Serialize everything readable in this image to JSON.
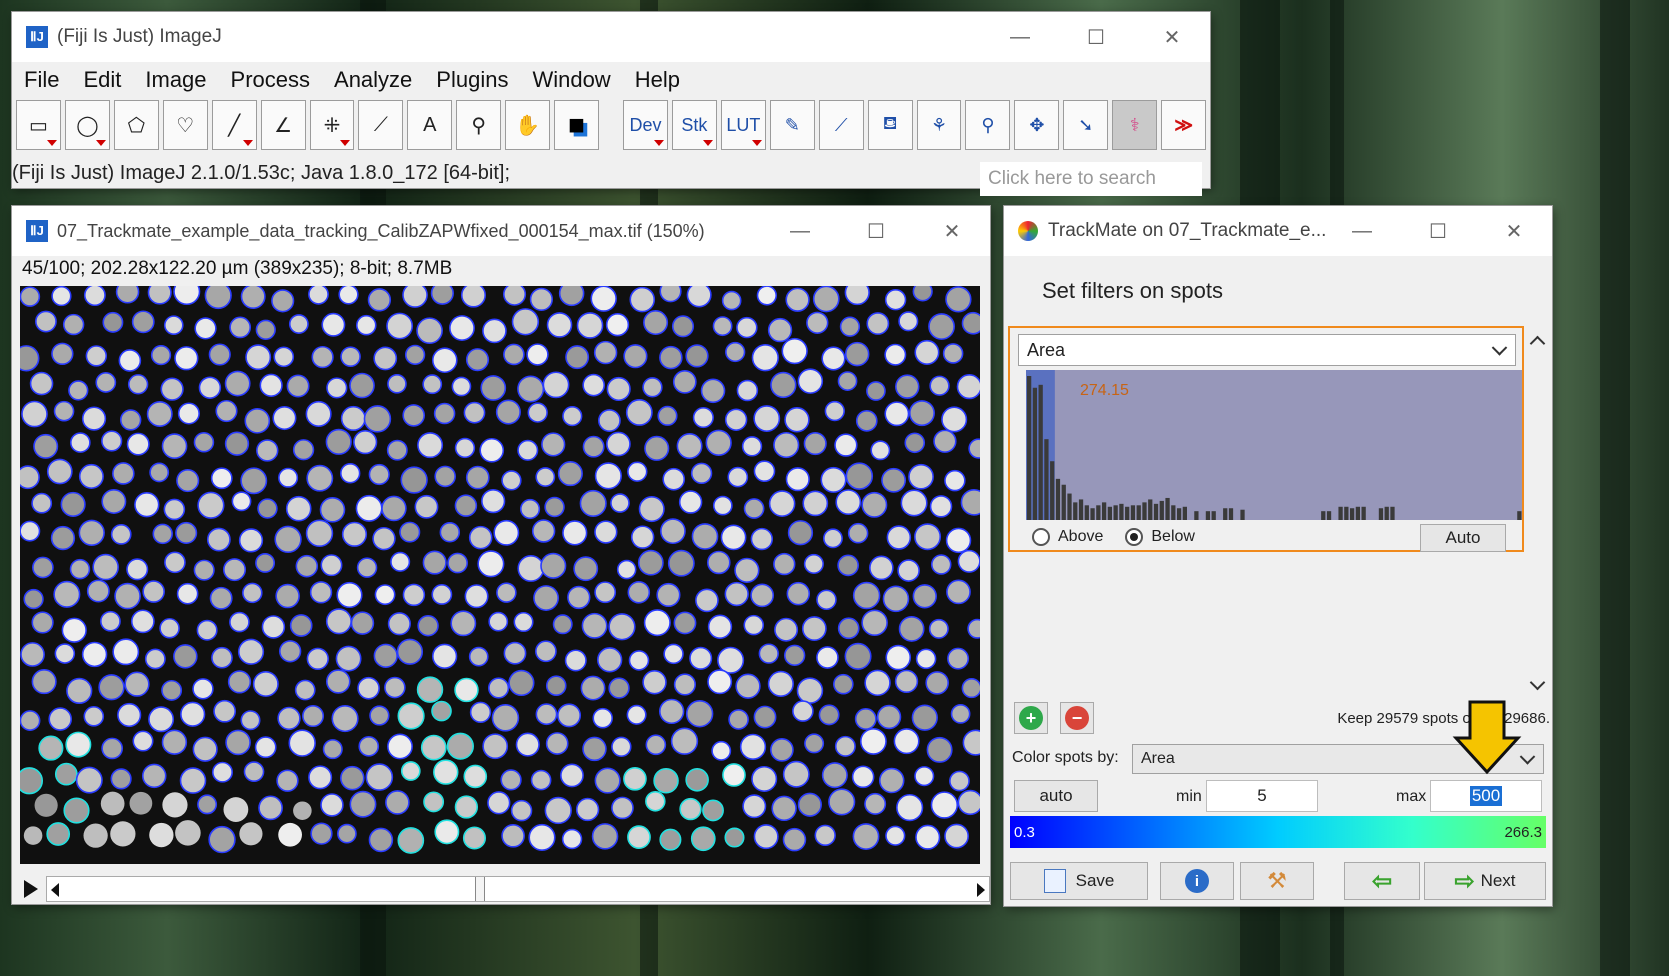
{
  "imagej": {
    "title": "(Fiji Is Just) ImageJ",
    "menus": [
      "File",
      "Edit",
      "Image",
      "Process",
      "Analyze",
      "Plugins",
      "Window",
      "Help"
    ],
    "tools": [
      {
        "name": "rectangle-tool-icon",
        "glyph": "▭",
        "dropdown": true
      },
      {
        "name": "oval-tool-icon",
        "glyph": "◯",
        "dropdown": true
      },
      {
        "name": "polygon-tool-icon",
        "glyph": "⬠",
        "dropdown": false
      },
      {
        "name": "freehand-tool-icon",
        "glyph": "♡",
        "dropdown": false
      },
      {
        "name": "line-tool-icon",
        "glyph": "╱",
        "dropdown": true
      },
      {
        "name": "angle-tool-icon",
        "glyph": "∠",
        "dropdown": false
      },
      {
        "name": "multipoint-tool-icon",
        "glyph": "⁜",
        "dropdown": true
      },
      {
        "name": "wand-tool-icon",
        "glyph": "⟋",
        "dropdown": false
      },
      {
        "name": "text-tool-icon",
        "glyph": "A",
        "dropdown": false
      },
      {
        "name": "magnifier-tool-icon",
        "glyph": "⚲",
        "dropdown": false
      },
      {
        "name": "hand-tool-icon",
        "glyph": "✋",
        "dropdown": false
      },
      {
        "name": "color-picker-icon",
        "glyph": "■",
        "dropdown": false
      }
    ],
    "tools2": [
      {
        "name": "dev-menu",
        "label": "Dev",
        "dropdown": true
      },
      {
        "name": "stk-menu",
        "label": "Stk",
        "dropdown": true
      },
      {
        "name": "lut-menu",
        "label": "LUT",
        "dropdown": true
      },
      {
        "name": "pencil-tool-icon",
        "label": "✎",
        "dropdown": false
      },
      {
        "name": "brush-tool-icon",
        "label": "⟋",
        "dropdown": false
      },
      {
        "name": "flood-fill-icon",
        "label": "⛾",
        "dropdown": false
      },
      {
        "name": "segmentation-icon",
        "label": "⚘",
        "dropdown": false
      },
      {
        "name": "zoom-lens-icon",
        "label": "⚲",
        "dropdown": false
      },
      {
        "name": "move-tool-icon",
        "label": "✥",
        "dropdown": false
      },
      {
        "name": "arrow-tool-icon",
        "label": "➘",
        "dropdown": false
      },
      {
        "name": "tree-tool-icon",
        "label": "⚕",
        "dropdown": false,
        "selected": true
      },
      {
        "name": "more-tools-icon",
        "label": "≫",
        "dropdown": false
      }
    ],
    "status": "(Fiji Is Just) ImageJ 2.1.0/1.53c; Java 1.8.0_172 [64-bit];",
    "search_placeholder": "Click here to search"
  },
  "image_window": {
    "title": "07_Trackmate_example_data_tracking_CalibZAPWfixed_000154_max.tif (150%)",
    "info": "45/100; 202.28x122.20 µm (389x235); 8-bit; 8.7MB"
  },
  "trackmate": {
    "title": "TrackMate on 07_Trackmate_e...",
    "heading": "Set filters on spots",
    "filter_feature": "Area",
    "threshold_value": "274.15",
    "above_label": "Above",
    "below_label": "Below",
    "selected_direction": "Below",
    "auto_label": "Auto",
    "keep_text": "Keep 29579 spots out of 29686.",
    "color_by_label": "Color spots by:",
    "color_by_value": "Area",
    "auto_button": "auto",
    "min_label": "min",
    "min_value": "5",
    "max_label": "max",
    "max_value": "500",
    "colorbar_min": "0.3",
    "colorbar_max": "266.3",
    "save_label": "Save",
    "next_label": "Next",
    "histogram_bins": [
      98,
      90,
      92,
      55,
      40,
      28,
      24,
      18,
      12,
      14,
      10,
      8,
      10,
      12,
      9,
      10,
      11,
      9,
      10,
      10,
      12,
      14,
      11,
      13,
      15,
      10,
      8,
      9,
      0,
      6,
      0,
      6,
      6,
      0,
      8,
      8,
      0,
      7,
      0,
      0,
      0,
      0,
      0,
      0,
      0,
      0,
      0,
      0,
      0,
      0,
      0,
      6,
      6,
      0,
      9,
      9,
      8,
      9,
      9,
      0,
      0,
      8,
      9,
      9,
      0,
      0,
      0,
      0,
      0,
      0,
      0,
      0,
      0,
      0,
      0,
      0,
      0,
      0,
      0,
      0,
      0,
      0,
      0,
      0,
      0,
      6
    ],
    "colors": {
      "accent": "#f08a1c",
      "histogram_bg": "#9797ba",
      "threshold_text": "#c86414",
      "arrow": "#f5c400"
    }
  }
}
